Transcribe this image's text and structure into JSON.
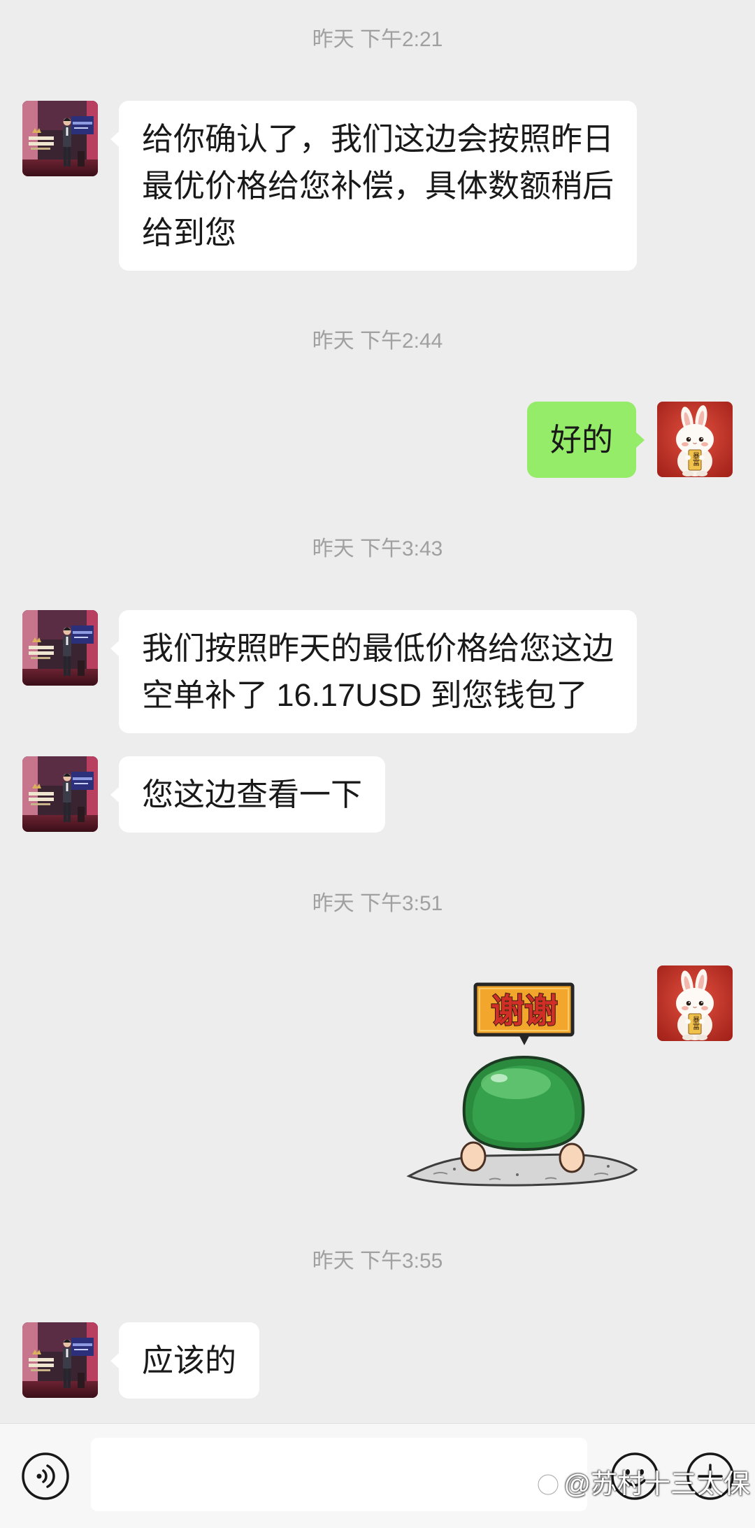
{
  "colors": {
    "background": "#ededed",
    "incoming_bubble": "#ffffff",
    "outgoing_bubble": "#95ec69",
    "timestamp": "#a0a0a0",
    "toolbar": "#f7f7f7"
  },
  "chat": [
    {
      "time": "昨天 下午2:21",
      "messages": [
        {
          "incoming": true,
          "lines": [
            "给你确认了，我们这边会按照昨日",
            "最优价格给您补偿，具体数额稍后",
            "给到您"
          ]
        }
      ]
    },
    {
      "time": "昨天 下午2:44",
      "messages": [
        {
          "incoming": false,
          "lines": [
            "好的"
          ]
        }
      ]
    },
    {
      "time": "昨天 下午3:43",
      "messages": [
        {
          "incoming": true,
          "lines": [
            "我们按照昨天的最低价格给您这边",
            "空单补了 16.17USD 到您钱包了"
          ]
        },
        {
          "incoming": true,
          "lines": [
            "您这边查看一下"
          ]
        }
      ]
    },
    {
      "time": "昨天 下午3:51",
      "messages": [
        {
          "incoming": false,
          "sticker_text": "谢谢"
        }
      ]
    },
    {
      "time": "昨天 下午3:55",
      "messages": [
        {
          "incoming": true,
          "lines": [
            "应该的"
          ]
        }
      ]
    }
  ],
  "avatars": {
    "self": {
      "sign_text": "暴富"
    }
  },
  "input": {
    "value": ""
  },
  "icons": {
    "voice": "voice-icon",
    "emoji": "emoji-icon",
    "more": "plus-icon",
    "watermark_logo": "watermark-logo-icon"
  },
  "watermark": "@苏村十三太保"
}
